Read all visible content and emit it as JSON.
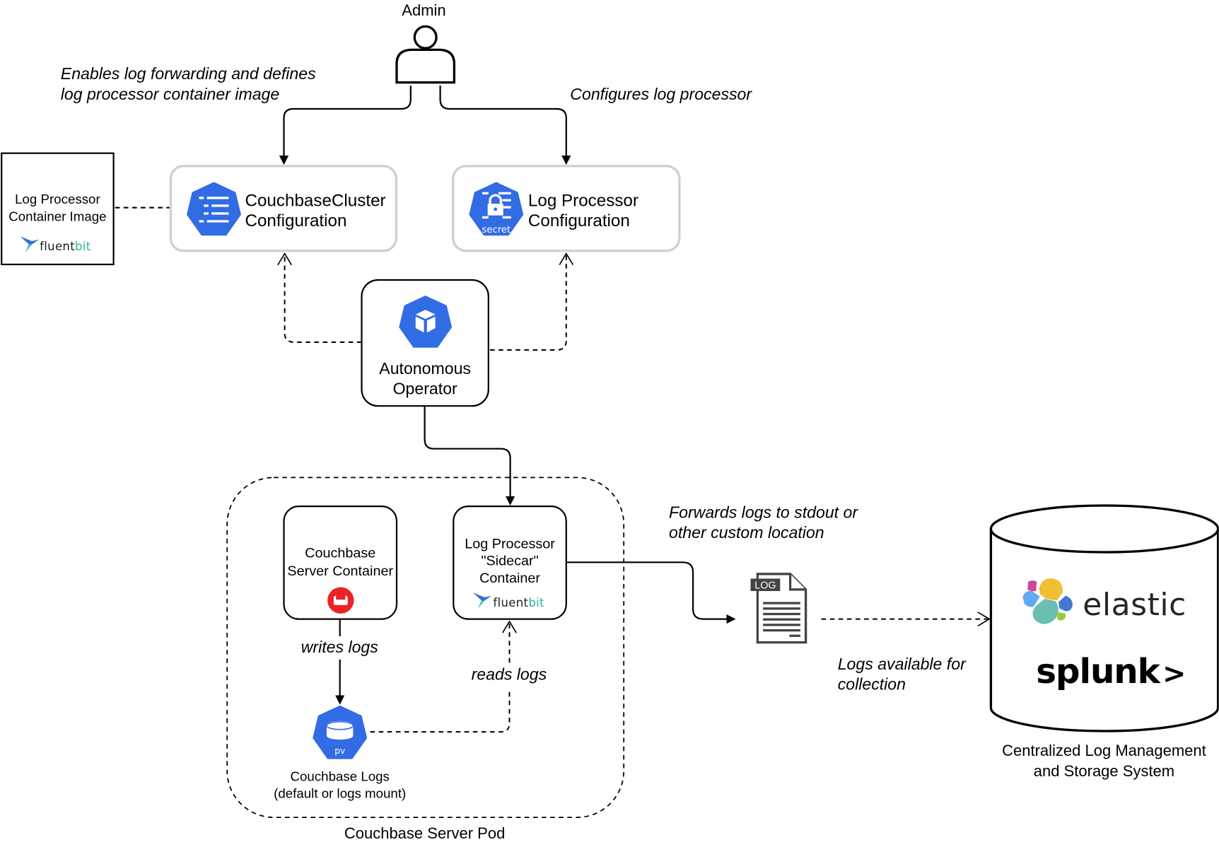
{
  "diagram": {
    "admin": {
      "label": "Admin"
    },
    "annotations": {
      "enables_line1": "Enables log forwarding and defines",
      "enables_line2": "log processor container image",
      "configures": "Configures log processor",
      "forwards_line1": "Forwards logs to stdout or",
      "forwards_line2": "other custom location",
      "available_line1": "Logs available for",
      "available_line2": "collection",
      "writes": "writes logs",
      "reads": "reads logs"
    },
    "container_image": {
      "line1": "Log Processor",
      "line2": "Container Image",
      "logo_fluent": "fluent",
      "logo_bit": "bit"
    },
    "couchbase_cluster_config": {
      "line1": "CouchbaseCluster",
      "line2": "Configuration",
      "icon": "k8s-crd-icon"
    },
    "log_processor_config": {
      "line1": "Log Processor",
      "line2": "Configuration",
      "icon_label": "secret"
    },
    "operator": {
      "line1": "Autonomous",
      "line2": "Operator"
    },
    "pod": {
      "label": "Couchbase Server Pod",
      "server_container": {
        "line1": "Couchbase",
        "line2": "Server Container"
      },
      "sidecar": {
        "line1": "Log Processor",
        "line2": "\"Sidecar\"",
        "line3": "Container",
        "logo_fluent": "fluent",
        "logo_bit": "bit"
      },
      "volume": {
        "icon_label": "pv",
        "line1": "Couchbase Logs",
        "line2": "(default or logs mount)"
      }
    },
    "log_file": {
      "badge": "LOG"
    },
    "storage": {
      "elastic": "elastic",
      "splunk": "splunk",
      "splunk_suffix": ">",
      "line1": "Centralized Log Management",
      "line2": "and Storage System"
    },
    "colors": {
      "k8s_blue": "#326CE5",
      "couchbase_red": "#EA2328",
      "config_border": "#CFCFCF",
      "elastic_yellow": "#F0BF34",
      "elastic_teal": "#6ABFB1",
      "elastic_blue": "#4479D0",
      "elastic_lightblue": "#62A9F2",
      "elastic_pink": "#D2479A",
      "elastic_green": "#A0C73B"
    }
  }
}
